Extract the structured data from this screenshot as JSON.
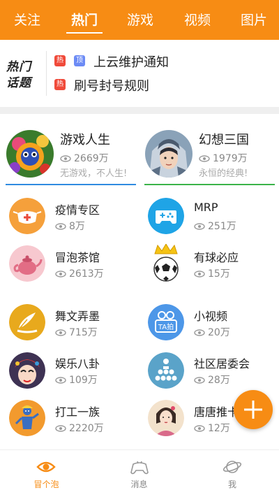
{
  "top_tabs": [
    {
      "label": "关注"
    },
    {
      "label": "热门"
    },
    {
      "label": "游戏"
    },
    {
      "label": "视频"
    },
    {
      "label": "图片"
    }
  ],
  "hot_topics": {
    "logo_line1": "热门",
    "logo_line2": "话题",
    "hot_badge": "热",
    "top_badge": "顶",
    "items": [
      {
        "text": "上云维护通知"
      },
      {
        "text": "刷号封号规则"
      }
    ]
  },
  "featured": [
    {
      "title": "游戏人生",
      "views": "2669万",
      "subtitle": "无游戏，不人生!",
      "accent": "#2f8be0"
    },
    {
      "title": "幻想三国",
      "views": "1979万",
      "subtitle": "永恒的经典!",
      "accent": "#3bb34a"
    }
  ],
  "items": [
    {
      "name": "疫情专区",
      "views": "8万",
      "icon": "mask-icon"
    },
    {
      "name": "MRP",
      "views": "251万",
      "icon": "gamepad-icon"
    },
    {
      "name": "冒泡茶馆",
      "views": "2613万",
      "icon": "teapot-icon"
    },
    {
      "name": "有球必应",
      "views": "15万",
      "icon": "soccer-ball-icon"
    },
    {
      "name": "舞文弄墨",
      "views": "715万",
      "icon": "quill-icon"
    },
    {
      "name": "小视频",
      "views": "20万",
      "icon": "ta-camera-icon",
      "icon_text": "TA拍"
    },
    {
      "name": "娱乐八卦",
      "views": "109万",
      "icon": "opera-face-icon"
    },
    {
      "name": "社区居委会",
      "views": "28万",
      "icon": "community-icon"
    },
    {
      "name": "打工一族",
      "views": "2220万",
      "icon": "worker-icon"
    },
    {
      "name": "唐唐推卡",
      "views": "12万",
      "icon": "lady-portrait-icon"
    }
  ],
  "bottom_nav": [
    {
      "label": "冒个泡",
      "icon": "eye-icon"
    },
    {
      "label": "消息",
      "icon": "gamepad-outline-icon"
    },
    {
      "label": "我",
      "icon": "planet-icon"
    }
  ],
  "colors": {
    "brand": "#f78c14"
  }
}
